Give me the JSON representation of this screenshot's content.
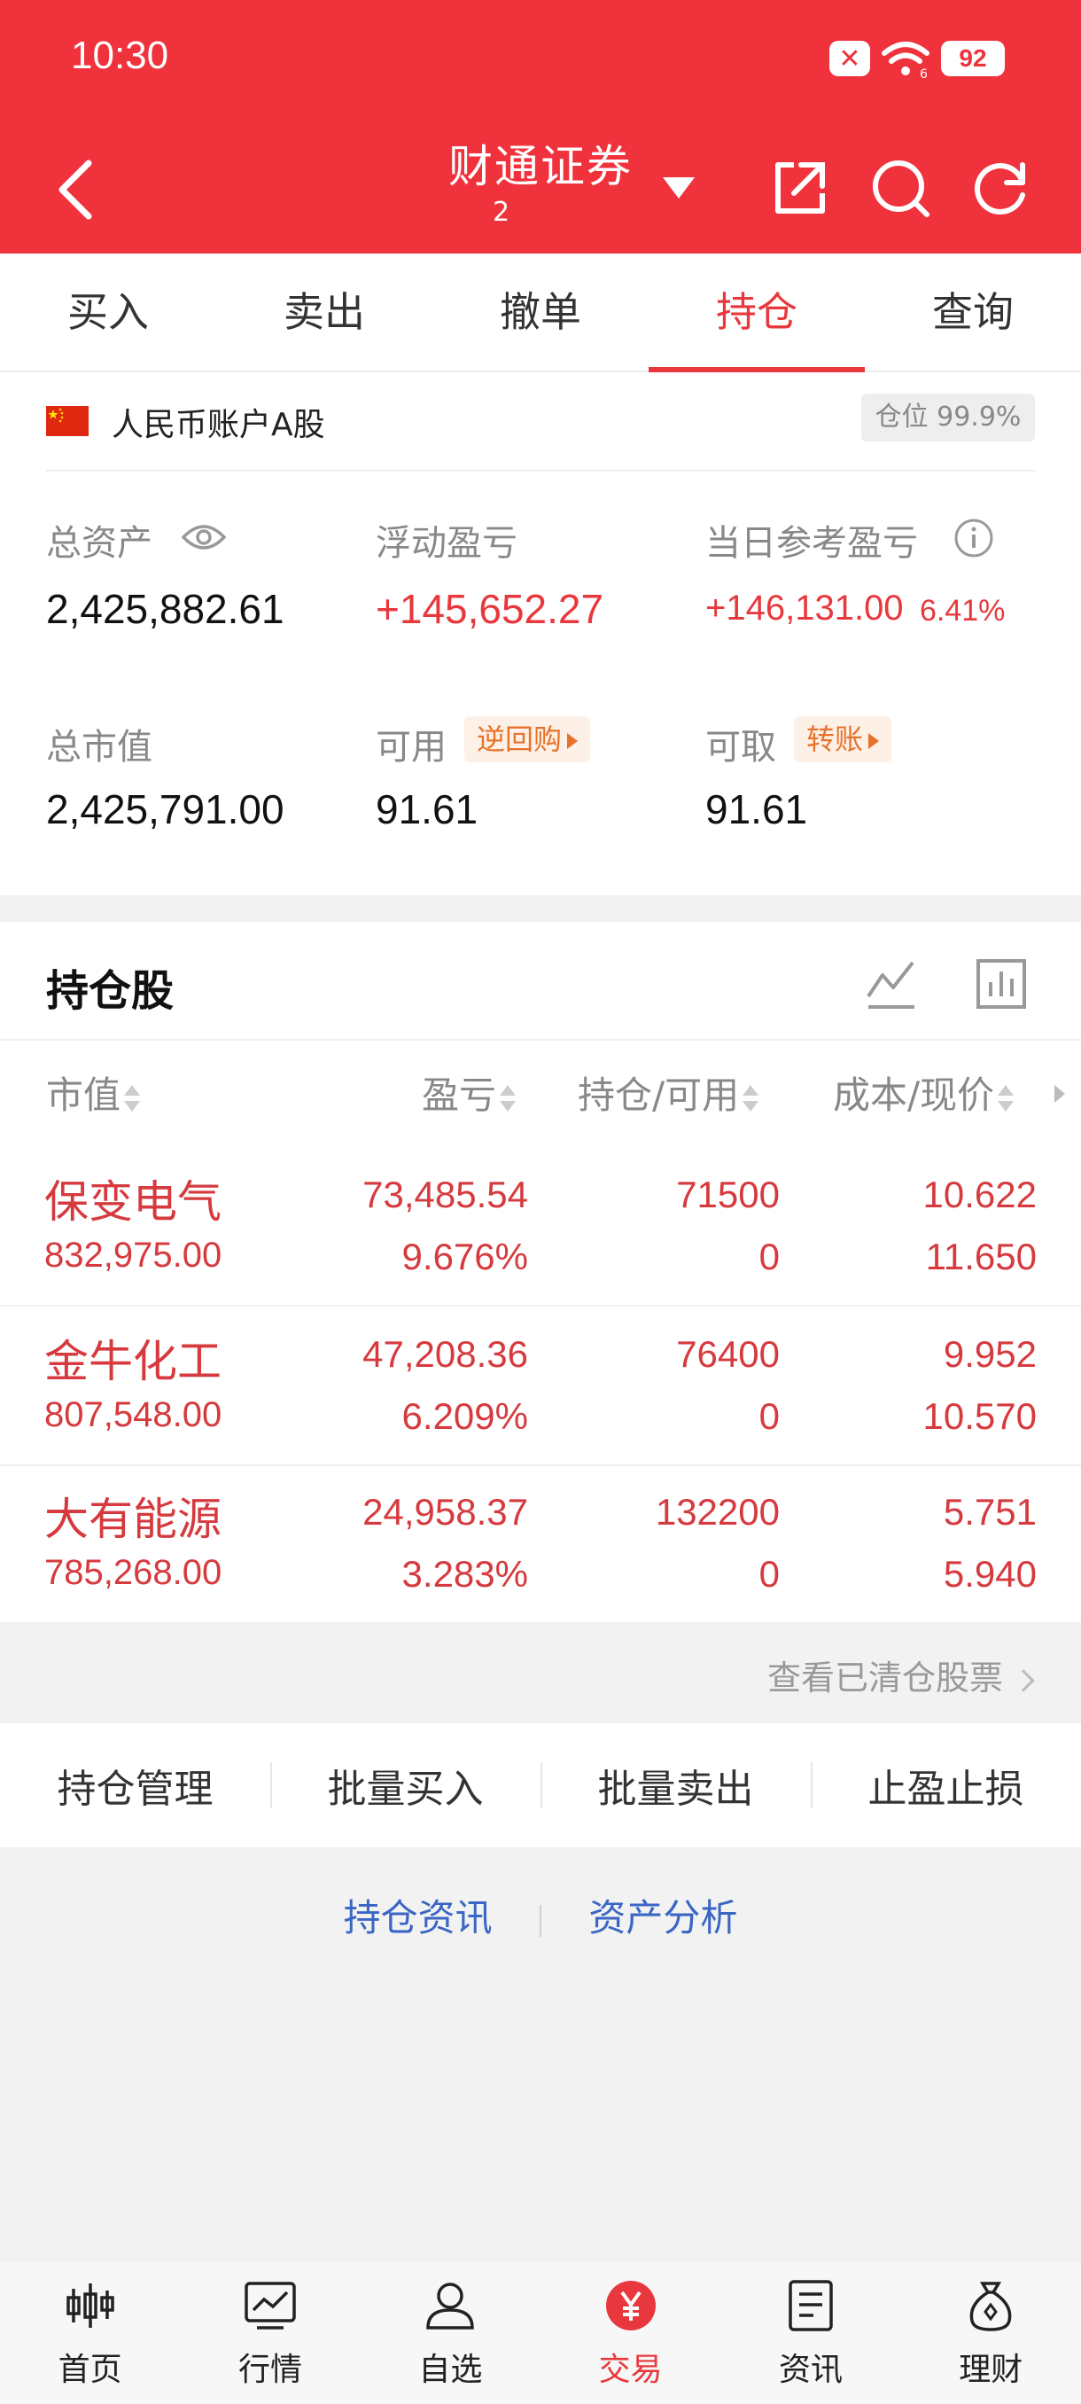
{
  "status_bar": {
    "time": "10:30",
    "battery": "92",
    "wifi_badge": "6"
  },
  "header": {
    "title": "财通证券",
    "sub": "2"
  },
  "tabs": [
    {
      "label": "买入",
      "active": false
    },
    {
      "label": "卖出",
      "active": false
    },
    {
      "label": "撤单",
      "active": false
    },
    {
      "label": "持仓",
      "active": true
    },
    {
      "label": "查询",
      "active": false
    }
  ],
  "account": {
    "name": "人民币账户A股",
    "position_badge": "仓位 99.9%",
    "total_assets_label": "总资产",
    "total_assets": "2,425,882.61",
    "floating_pl_label": "浮动盈亏",
    "floating_pl": "+145,652.27",
    "daily_pl_label": "当日参考盈亏",
    "daily_pl": "+146,131.00",
    "daily_pl_pct": "6.41%",
    "market_value_label": "总市值",
    "market_value": "2,425,791.00",
    "available_label": "可用",
    "available": "91.61",
    "reverse_repo": "逆回购",
    "withdrawable_label": "可取",
    "withdrawable": "91.61",
    "transfer": "转账"
  },
  "holdings": {
    "title": "持仓股",
    "columns": [
      "市值",
      "盈亏",
      "持仓/可用",
      "成本/现价"
    ],
    "rows": [
      {
        "name": "保变电气",
        "market_value": "832,975.00",
        "pl": "73,485.54",
        "pl_pct": "9.676%",
        "holding": "71500",
        "available": "0",
        "cost": "10.622",
        "price": "11.650"
      },
      {
        "name": "金牛化工",
        "market_value": "807,548.00",
        "pl": "47,208.36",
        "pl_pct": "6.209%",
        "holding": "76400",
        "available": "0",
        "cost": "9.952",
        "price": "10.570"
      },
      {
        "name": "大有能源",
        "market_value": "785,268.00",
        "pl": "24,958.37",
        "pl_pct": "3.283%",
        "holding": "132200",
        "available": "0",
        "cost": "5.751",
        "price": "5.940"
      }
    ],
    "cleared_link": "查看已清仓股票"
  },
  "actions": [
    "持仓管理",
    "批量买入",
    "批量卖出",
    "止盈止损"
  ],
  "links": [
    "持仓资讯",
    "资产分析"
  ],
  "bottom_nav": [
    {
      "label": "首页",
      "icon": "candlestick-icon"
    },
    {
      "label": "行情",
      "icon": "chart-icon"
    },
    {
      "label": "自选",
      "icon": "user-icon"
    },
    {
      "label": "交易",
      "icon": "yuan-icon",
      "active": true
    },
    {
      "label": "资讯",
      "icon": "news-icon"
    },
    {
      "label": "理财",
      "icon": "money-bag-icon"
    }
  ],
  "colors": {
    "brand_red": "#f0323c",
    "gain_red": "#d63a3e",
    "link_blue": "#3a66c4",
    "pill_orange": "#e8722a"
  }
}
